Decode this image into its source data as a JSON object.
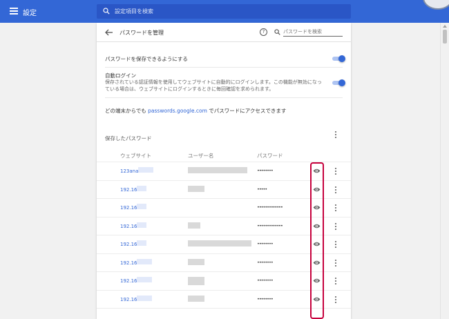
{
  "header": {
    "title": "設定",
    "search_placeholder": "設定項目を検索"
  },
  "page": {
    "title": "パスワードを管理",
    "search_placeholder": "パスワードを検索"
  },
  "settings": {
    "offer_to_save": "パスワードを保存できるようにする",
    "auto_signin_title": "自動ログイン",
    "auto_signin_desc": "保存されている認証情報を使用してウェブサイトに自動的にログインします。この機能が無効になっている場合は、ウェブサイトにログインするときに毎回確認を求められます。",
    "access_prefix": "どの端末からでも ",
    "access_link": "passwords.google.com",
    "access_suffix": " でパスワードにアクセスできます"
  },
  "saved": {
    "title": "保存したパスワード",
    "columns": [
      "ウェブサイト",
      "ユーザー名",
      "パスワード"
    ],
    "rows": [
      {
        "site": "123anal",
        "password": "••••••••"
      },
      {
        "site": "192.168",
        "password": "•••••"
      },
      {
        "site": "192.168",
        "password": "•••••••••••••"
      },
      {
        "site": "192.168",
        "password": "•••••••••••••"
      },
      {
        "site": "192.168",
        "password": "••••••••"
      },
      {
        "site": "192.168",
        "password": "••••••••"
      },
      {
        "site": "192.168",
        "password": "••••••••"
      },
      {
        "site": "192.166",
        "password": "••••••••"
      }
    ]
  },
  "colors": {
    "header": "#3367d6",
    "accent": "#3367d6",
    "highlight": "#c6003c"
  }
}
